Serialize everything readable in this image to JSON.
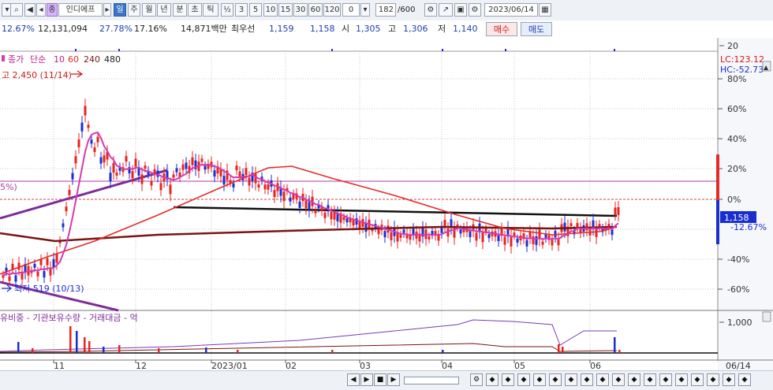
{
  "toolbar": {
    "search_icon": "search-icon",
    "sound_icon": "speaker-icon",
    "stock_tag": "종",
    "stock_name": "인디에프",
    "periods": [
      "일",
      "주",
      "월",
      "년",
      "분",
      "초",
      "틱"
    ],
    "active_period": "일",
    "half_label": "½",
    "intervals": [
      "3",
      "5",
      "10",
      "15",
      "30",
      "60",
      "120"
    ],
    "interval_value": "0",
    "count_value": "182",
    "count_total": "/600",
    "date_value": "2023/06/14"
  },
  "quote": {
    "change_pct": "12.67%",
    "volume": "12,131,094",
    "turnover_pct": "27.78%",
    "ratio_pct": "17.16%",
    "amount": "14,871백만",
    "best_offer_label": "최우선",
    "best_offer_1": "1,159",
    "best_offer_2": "1,158",
    "open_label": "시",
    "open_value": "1,305",
    "high_label": "고",
    "high_value": "1,306",
    "low_label": "저",
    "low_value": "1,140",
    "buy_label": "매수",
    "sell_label": "매도"
  },
  "price_chart": {
    "legend": [
      "종가",
      "단순",
      "10",
      "60",
      "240",
      "480"
    ],
    "high_note": "고 2,450 (11/14)",
    "low_note": "최저 519 (10/13)",
    "left_pct_note": "5%)",
    "lc_label": "LC:123.12",
    "hc_label": "HC:-52.73",
    "y_ticks": [
      "80%",
      "60%",
      "40%",
      "20%",
      "0%",
      "-12.67%",
      "-20%",
      "-40%",
      "-60%"
    ],
    "current_price_box": "1,158",
    "top_volume_tick": "20"
  },
  "sub_chart": {
    "legend": "유비중 - 기관보유수량 - 거래대금 - 억",
    "y_tick": "1,000"
  },
  "x_axis": [
    "11",
    "12",
    "2023/01",
    "02",
    "03",
    "04",
    "05",
    "06"
  ],
  "x_axis_end": "06/14",
  "colors": {
    "up": "#e8231c",
    "down": "#1a2ecf",
    "ma10": "#d43ab4",
    "ma60": "#e52a2a",
    "ma240": "#7a1414",
    "line_black": "#111111",
    "trend_purple": "#7d2d9a"
  },
  "scroll": {
    "buttons": [
      "◀",
      "▶",
      "■",
      "▶",
      "—",
      "—",
      "—",
      "■",
      "■",
      "■",
      "■",
      "■",
      "■"
    ]
  }
}
